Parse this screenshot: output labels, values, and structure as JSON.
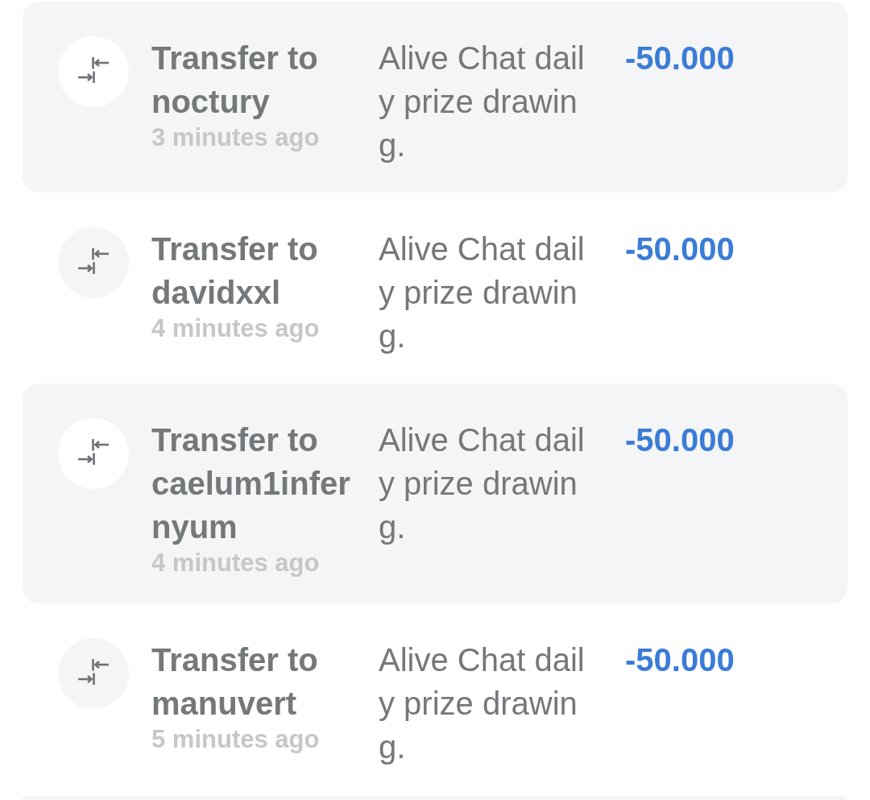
{
  "transactions": [
    {
      "title": "Transfer to noctury",
      "time": "3 minutes ago",
      "description": "Alive Chat daily prize drawing.",
      "amount": "-50.000"
    },
    {
      "title": "Transfer to davidxxl",
      "time": "4 minutes ago",
      "description": "Alive Chat daily prize drawing.",
      "amount": "-50.000"
    },
    {
      "title": "Transfer to caelum1infernyum",
      "time": "4 minutes ago",
      "description": "Alive Chat daily prize drawing.",
      "amount": "-50.000"
    },
    {
      "title": "Transfer to manuvert",
      "time": "5 minutes ago",
      "description": "Alive Chat daily prize drawing.",
      "amount": "-50.000"
    }
  ]
}
